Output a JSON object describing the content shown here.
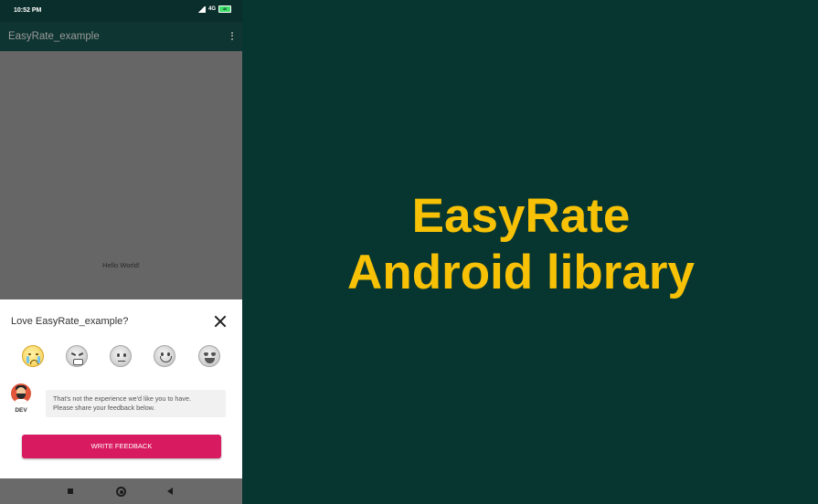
{
  "status_bar": {
    "time": "10:52 PM",
    "network": "4G",
    "battery": "46"
  },
  "app_bar": {
    "title": "EasyRate_example",
    "more_icon": "more-vert-icon"
  },
  "content": {
    "text": "Hello World!"
  },
  "rate_dialog": {
    "title": "Love EasyRate_example?",
    "close_icon": "close-icon",
    "ratings": [
      "crying-face-icon",
      "angry-face-icon",
      "neutral-face-icon",
      "smiling-face-icon",
      "heart-eyes-face-icon"
    ],
    "selected_rating": 1,
    "dev_label": "DEV",
    "message": "That's not the experience we'd like you to have.\nPlease share your feedback below.",
    "button_label": "WRITE FEEDBACK",
    "button_color": "#d81b60"
  },
  "nav_bar": {
    "icons": [
      "recent-apps-icon",
      "home-icon",
      "back-icon"
    ]
  },
  "banner": {
    "line1": "EasyRate",
    "line2": "Android library",
    "text_color": "#f7c106",
    "background": "#073630"
  }
}
